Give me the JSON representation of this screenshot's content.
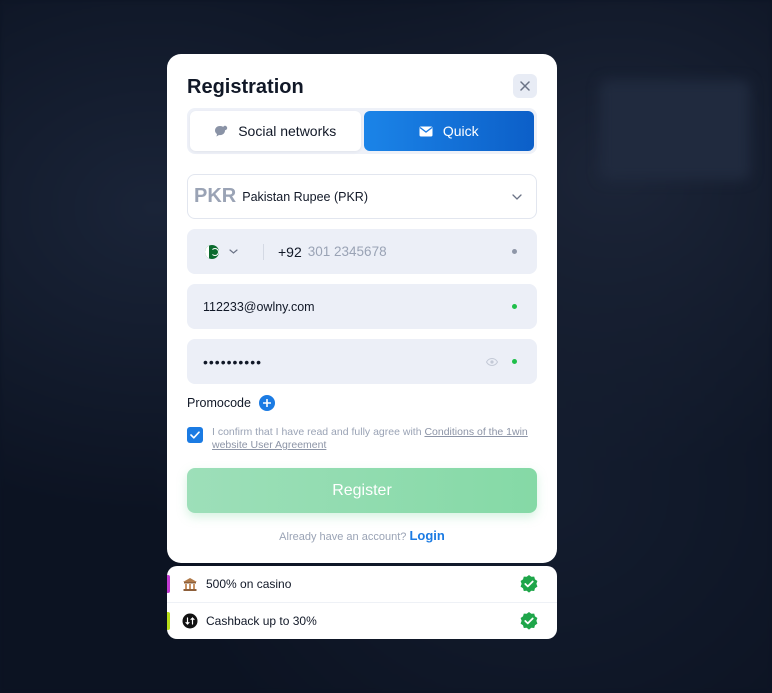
{
  "modal": {
    "title": "Registration",
    "tabs": [
      {
        "label": "Social networks",
        "icon": "chat-bubble-icon",
        "active": false
      },
      {
        "label": "Quick",
        "icon": "envelope-icon",
        "active": true
      }
    ],
    "currency": {
      "code": "PKR",
      "name": "Pakistan Rupee (PKR)"
    },
    "phone": {
      "prefix": "+92",
      "placeholder": "301 2345678",
      "value": ""
    },
    "email": {
      "value": "112233@owlny.com"
    },
    "password": {
      "value": "••••••••••"
    },
    "promo_label": "Promocode",
    "agreement": {
      "checked": true,
      "text": "I confirm that I have read and fully agree with",
      "link": "Conditions of the 1win website User Agreement"
    },
    "register_label": "Register",
    "login_prompt": "Already have an account?",
    "login_label": "Login"
  },
  "bonuses": [
    {
      "label": "500% on casino",
      "icon": "casino-building-icon",
      "bar_color": "#c33bd3"
    },
    {
      "label": "Cashback up to 30%",
      "icon": "cashback-coin-icon",
      "bar_color": "#b9de1a"
    }
  ],
  "colors": {
    "accent": "#1b7be3",
    "register_button": "#8fdcae",
    "valid_dot": "#1fbf4a",
    "badge_green": "#1fa64a"
  }
}
